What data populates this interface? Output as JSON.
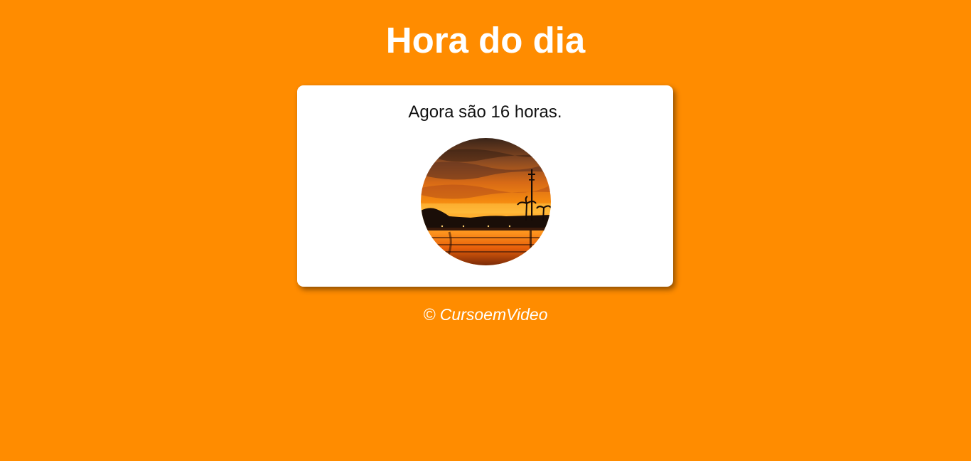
{
  "header": {
    "title": "Hora do dia"
  },
  "card": {
    "message": "Agora são 16 horas.",
    "image": {
      "description_icon": "sunset-photo",
      "shape": "circle"
    }
  },
  "footer": {
    "credit": "© CursoemVideo"
  },
  "colors": {
    "background": "#ff8c00",
    "card_background": "#ffffff",
    "title_text": "#ffffff",
    "body_text": "#111111"
  }
}
